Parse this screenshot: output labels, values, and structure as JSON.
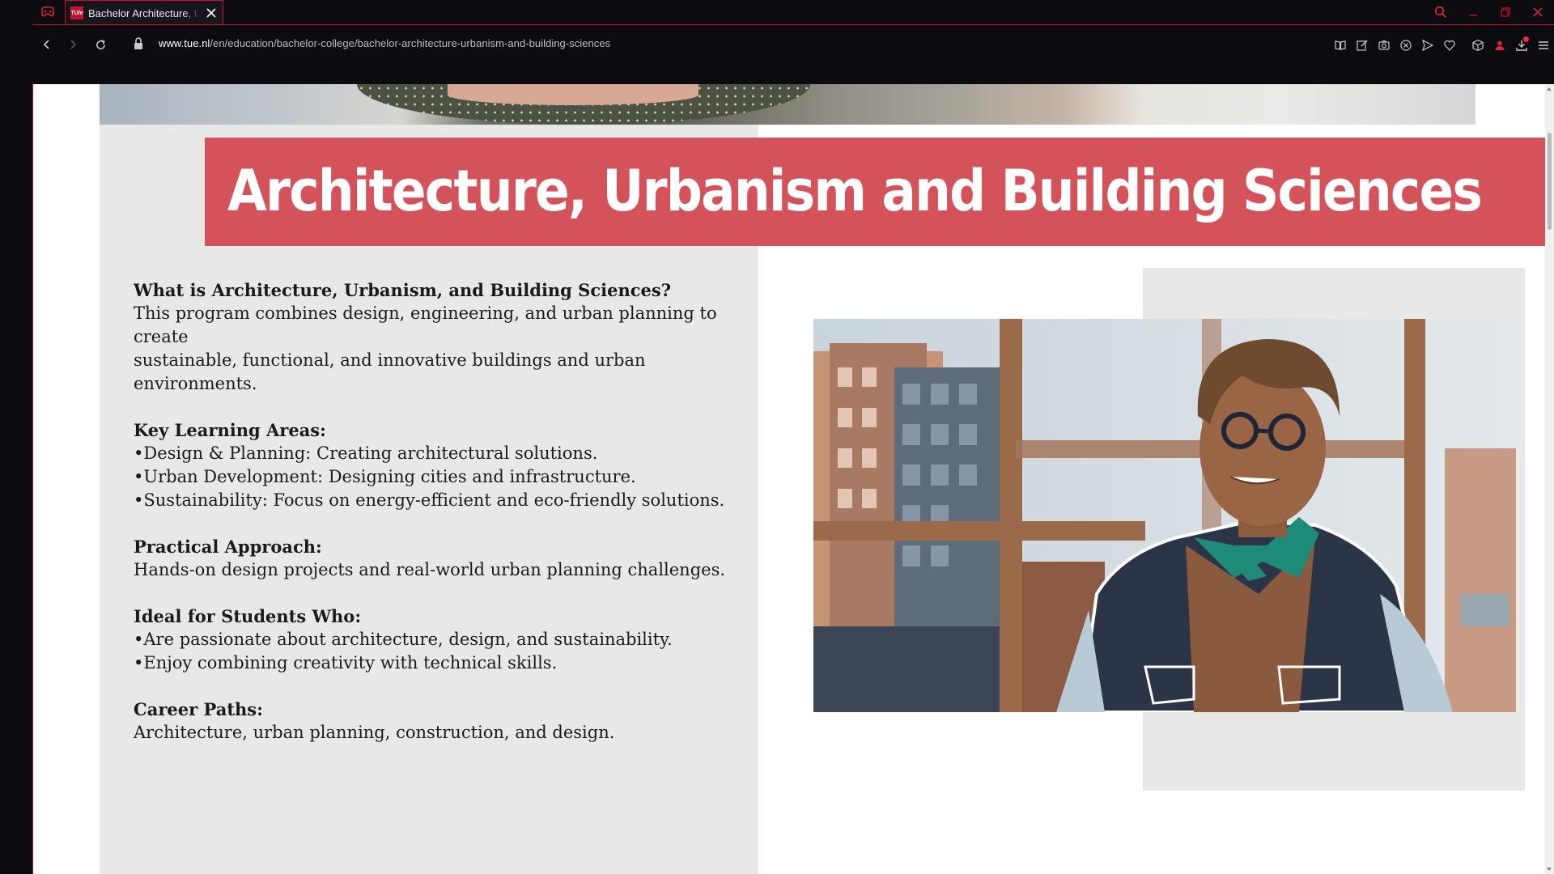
{
  "browser": {
    "tab": {
      "favicon_text": "TU/e",
      "title": "Bachelor Architecture, Urbanism and Building Sciences"
    },
    "url": {
      "domain": "www.tue.nl",
      "path": "/en/education/bachelor-college/bachelor-architecture-urbanism-and-building-sciences"
    },
    "accent_color": "#c8102e"
  },
  "page": {
    "title": "Architecture, Urbanism and Building Sciences",
    "banner_color": "#d4525a",
    "sections": [
      {
        "heading": "What is Architecture, Urbanism, and Building Sciences?",
        "lines": [
          "This program combines design, engineering, and urban planning to create",
          "sustainable, functional, and innovative buildings and urban environments."
        ]
      },
      {
        "heading": "Key Learning Areas:",
        "lines": [
          "•Design & Planning: Creating architectural solutions.",
          "•Urban Development: Designing cities and infrastructure.",
          "•Sustainability: Focus on energy-efficient and eco-friendly solutions."
        ]
      },
      {
        "heading": "Practical Approach:",
        "lines": [
          "Hands-on design projects and real-world urban planning challenges."
        ]
      },
      {
        "heading": "Ideal for Students Who:",
        "lines": [
          "•Are passionate about architecture, design, and sustainability.",
          "•Enjoy combining creativity with technical skills."
        ]
      },
      {
        "heading": "Career Paths:",
        "lines": [
          "Architecture, urban planning, construction, and design."
        ]
      }
    ]
  }
}
